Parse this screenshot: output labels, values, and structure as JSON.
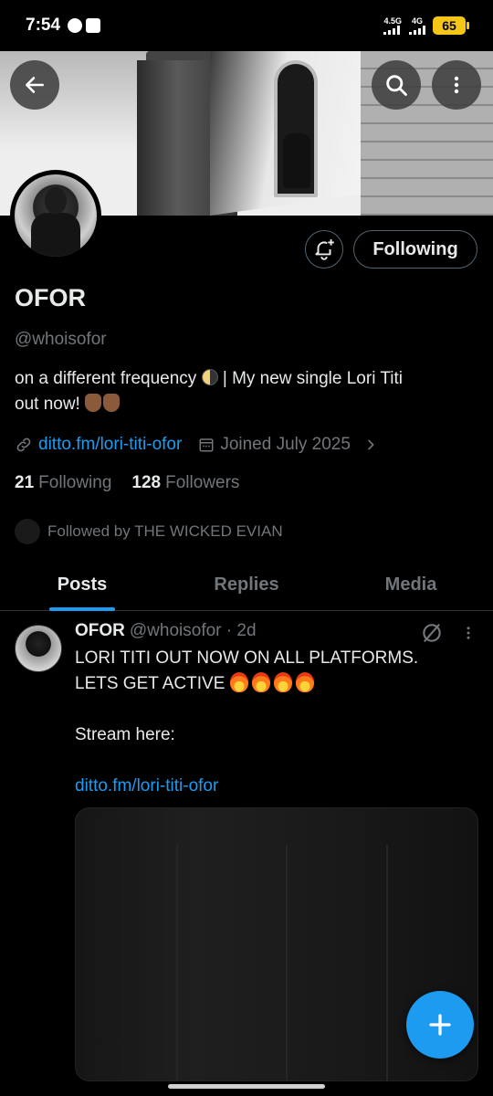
{
  "status_bar": {
    "time": "7:54",
    "network_1": "4.5G",
    "network_2": "4G",
    "battery": "65"
  },
  "profile": {
    "name": "OFOR",
    "handle": "@whoisofor",
    "bio_line_1_before": "on a different frequency ",
    "bio_line_1_after": " | My new single Lori Titi",
    "bio_line_2": "out now! ",
    "link": "ditto.fm/lori-titi-ofor",
    "joined": "Joined July 2025",
    "following_count": "21",
    "following_label": "Following",
    "followers_count": "128",
    "followers_label": "Followers",
    "followed_by": "Followed by THE WICKED EVIAN",
    "follow_button": "Following"
  },
  "tabs": [
    {
      "label": "Posts"
    },
    {
      "label": "Replies"
    },
    {
      "label": "Media"
    }
  ],
  "post": {
    "name": "OFOR",
    "handle_time": "@whoisofor · 2d",
    "line_1": "LORI TITI OUT NOW ON ALL PLATFORMS.",
    "line_2": "LETS GET ACTIVE ",
    "line_3": "Stream here:",
    "link": "ditto.fm/lori-titi-ofor"
  },
  "colors": {
    "accent": "#1d9bf0",
    "muted": "#71767b",
    "text": "#e7e9ea",
    "background": "#000000"
  },
  "icons": {
    "back": "arrow-left-icon",
    "search": "search-icon",
    "more": "more-vertical-icon",
    "bell": "bell-plus-icon",
    "link": "link-icon",
    "calendar": "calendar-icon",
    "chevron": "chevron-right-icon",
    "grok": "grok-icon",
    "compose": "plus-icon"
  }
}
